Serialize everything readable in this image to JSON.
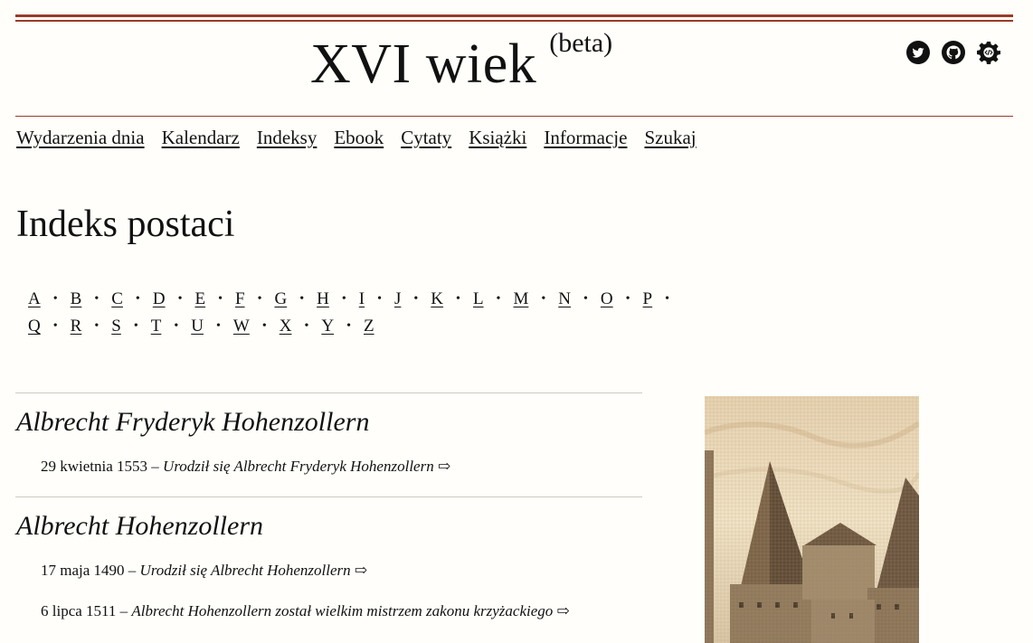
{
  "header": {
    "title": "XVI wiek",
    "beta": "(beta)",
    "icons": [
      "twitter-icon",
      "github-icon",
      "settings-code-icon"
    ]
  },
  "nav": {
    "items": [
      "Wydarzenia dnia",
      "Kalendarz",
      "Indeksy",
      "Ebook",
      "Cytaty",
      "Książki",
      "Informacje",
      "Szukaj"
    ]
  },
  "page": {
    "title": "Indeks postaci"
  },
  "letters": {
    "row1": [
      "A",
      "B",
      "C",
      "D",
      "E",
      "F",
      "G",
      "H",
      "I",
      "J",
      "K",
      "L",
      "M",
      "N",
      "O",
      "P"
    ],
    "row2": [
      "Q",
      "R",
      "S",
      "T",
      "U",
      "W",
      "X",
      "Y",
      "Z"
    ]
  },
  "entries": [
    {
      "name": "Albrecht Fryderyk Hohenzollern",
      "events": [
        {
          "date": "29 kwietnia 1553",
          "desc": "Urodził się Albrecht Fryderyk Hohenzollern"
        }
      ]
    },
    {
      "name": "Albrecht Hohenzollern",
      "events": [
        {
          "date": "17 maja 1490",
          "desc": "Urodził się Albrecht Hohenzollern"
        },
        {
          "date": "6 lipca 1511",
          "desc": "Albrecht Hohenzollern został wielkim mistrzem zakonu krzyżackiego"
        }
      ]
    }
  ],
  "colors": {
    "accent": "#9a3b2a",
    "background": "#fffefa"
  }
}
